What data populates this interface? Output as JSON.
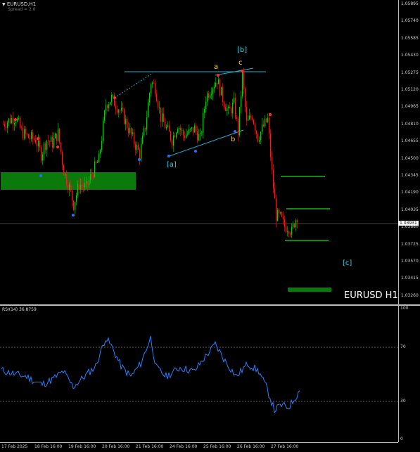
{
  "header": {
    "symbol_label": "EURUSD,H1",
    "spread_label": "Spread = 2.0"
  },
  "watermark": "EURUSD H1",
  "price_axis": [
    "1.05895",
    "1.05740",
    "1.05585",
    "1.05430",
    "1.05275",
    "1.05120",
    "1.04965",
    "1.04810",
    "1.04655",
    "1.04500",
    "1.04345",
    "1.04190",
    "1.04035",
    "1.03880",
    "1.03725",
    "1.03570",
    "1.03415",
    "1.03260"
  ],
  "current_price": "1.03931",
  "wave_labels": {
    "b_bracket": "[b]",
    "a": "a",
    "c": "c",
    "b": "b",
    "a_bracket": "[a]",
    "c_bracket": "[c]"
  },
  "rsi": {
    "label": "RSI(14) 36.8759",
    "axis": [
      "100",
      "70",
      "30",
      "0"
    ]
  },
  "time_axis": [
    "17 Feb 2025",
    "18 Feb 16:00",
    "19 Feb 16:00",
    "20 Feb 16:00",
    "21 Feb 16:00",
    "24 Feb 16:00",
    "25 Feb 16:00",
    "26 Feb 16:00",
    "27 Feb 16:00"
  ],
  "colors": {
    "bull": "#1fbf1f",
    "bear": "#d42a2a",
    "zone": "#0a7a0a",
    "trendline": "#20b0d0",
    "rsi_line": "#2a7fff",
    "wave_yellow": "#ffd21e",
    "wave_cyan": "#35d0e0"
  },
  "chart_data": [
    {
      "type": "candlestick",
      "title": "EURUSD,H1",
      "x": [
        "17 Feb 2025",
        "18 Feb 16:00",
        "19 Feb 16:00",
        "20 Feb 16:00",
        "21 Feb 16:00",
        "24 Feb 16:00",
        "25 Feb 16:00",
        "26 Feb 16:00",
        "27 Feb 16:00",
        "27 Feb 22:00"
      ],
      "close": [
        1.0484,
        1.047,
        1.042,
        1.0505,
        1.0468,
        1.0472,
        1.0525,
        1.0485,
        1.04,
        1.0393
      ],
      "ylim": [
        1.0326,
        1.059
      ]
    },
    {
      "type": "line",
      "title": "RSI(14) 36.8759",
      "x": [
        "17 Feb 2025",
        "18 Feb 16:00",
        "19 Feb 16:00",
        "20 Feb 16:00",
        "21 Feb 16:00",
        "24 Feb 16:00",
        "25 Feb 16:00",
        "26 Feb 16:00",
        "27 Feb 16:00",
        "27 Feb 22:00"
      ],
      "values": [
        53,
        45,
        42,
        78,
        52,
        50,
        72,
        45,
        22,
        37
      ],
      "levels": [
        70,
        30
      ],
      "ylim": [
        0,
        100
      ]
    }
  ]
}
